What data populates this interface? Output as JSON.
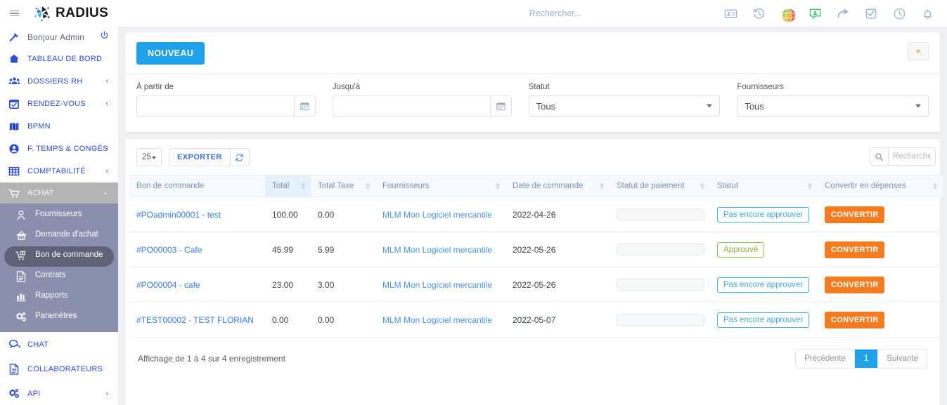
{
  "topbar": {
    "logo_text": "RADIUS",
    "search_placeholder": "Rechercher...",
    "search_value": "",
    "icons": [
      "id-card-icon",
      "history-icon",
      "globe-sphere-icon",
      "chat-person-icon",
      "share-arrow-icon",
      "checkbox-icon",
      "clock-icon",
      "bell-icon"
    ]
  },
  "sidebar": {
    "greeting": "Bonjour Admin",
    "items": [
      {
        "label": "TABLEAU DE BORD",
        "icon": "home-icon",
        "caret": false
      },
      {
        "label": "DOSSIERS RH",
        "icon": "people-icon",
        "caret": true
      },
      {
        "label": "RENDEZ-VOUS",
        "icon": "calendar-icon",
        "caret": true
      },
      {
        "label": "BPMN",
        "icon": "map-icon",
        "caret": false
      },
      {
        "label": "F. TEMPS & CONGÉS",
        "icon": "user-circle-icon",
        "caret": true
      },
      {
        "label": "COMPTABILITÉ",
        "icon": "table-icon",
        "caret": true
      }
    ],
    "achat": {
      "label": "ACHAT",
      "icon": "cart-icon",
      "sub_items": [
        {
          "label": "Fournisseurs",
          "icon": "user-outline-icon",
          "active": false
        },
        {
          "label": "Demande d'achat",
          "icon": "basket-icon",
          "active": false
        },
        {
          "label": "Bon de commande",
          "icon": "cart-plus-icon",
          "active": true
        },
        {
          "label": "Contrats",
          "icon": "document-icon",
          "active": false
        },
        {
          "label": "Rapports",
          "icon": "bar-chart-icon",
          "active": false
        },
        {
          "label": "Paramètres",
          "icon": "gears-icon",
          "active": false
        }
      ]
    },
    "bottom_items": [
      {
        "label": "CHAT",
        "icon": "chat-bubble-icon",
        "caret": false
      },
      {
        "label": "COLLABORATEURS",
        "icon": "document-icon",
        "caret": false
      },
      {
        "label": "API",
        "icon": "gears-icon",
        "caret": true
      }
    ]
  },
  "filters": {
    "new_button": "NOUVEAU",
    "collapse_icon": "double-chevron-left-icon",
    "from_label": "À partir de",
    "from_value": "",
    "to_label": "Jusqu'à",
    "to_value": "",
    "status_label": "Statut",
    "status_value": "Tous",
    "suppliers_label": "Fournisseurs",
    "suppliers_value": "Tous"
  },
  "table": {
    "page_length": "25",
    "export_label": "EXPORTER",
    "refresh_icon": "refresh-icon",
    "search_placeholder": "Rechercher",
    "search_value": "",
    "columns": [
      "Bon de commande",
      "Total",
      "Total Taxe",
      "Fournisseurs",
      "Date de commande",
      "Statut de paiement",
      "Statut",
      "Convertir en dépenses"
    ],
    "rows": [
      {
        "po": "#POadmin00001 - test",
        "total": "100.00",
        "tax": "0.00",
        "supplier": "MLM Mon Logiciel mercantile",
        "date": "2022-04-26",
        "payment_status": "",
        "status": "Pas encore approuver",
        "status_kind": "pending",
        "convert": "CONVERTIR"
      },
      {
        "po": "#PO00003 - Cafe",
        "total": "45.99",
        "tax": "5.99",
        "supplier": "MLM Mon Logiciel mercantile",
        "date": "2022-05-26",
        "payment_status": "",
        "status": "Approuvé",
        "status_kind": "approved",
        "convert": "CONVERTIR"
      },
      {
        "po": "#PO00004 - cafe",
        "total": "23.00",
        "tax": "3.00",
        "supplier": "MLM Mon Logiciel mercantile",
        "date": "2022-05-26",
        "payment_status": "",
        "status": "Pas encore approuver",
        "status_kind": "pending",
        "convert": "CONVERTIR"
      },
      {
        "po": "#TEST00002 - TEST FLORIAN",
        "total": "0.00",
        "tax": "0.00",
        "supplier": "MLM Mon Logiciel mercantile",
        "date": "2022-05-07",
        "payment_status": "",
        "status": "Pas encore approuver",
        "status_kind": "pending",
        "convert": "CONVERTIR"
      }
    ],
    "info": "Affichage de 1 à 4 sur 4 enregistrement",
    "pagination": {
      "prev": "Précédente",
      "current": "1",
      "next": "Suivante"
    }
  },
  "colors": {
    "accent_blue": "#1fa2e9",
    "link_blue": "#3b7ddd",
    "nav_blue": "#2b4cd4",
    "orange": "#f47b20",
    "green": "#8cc63e"
  }
}
